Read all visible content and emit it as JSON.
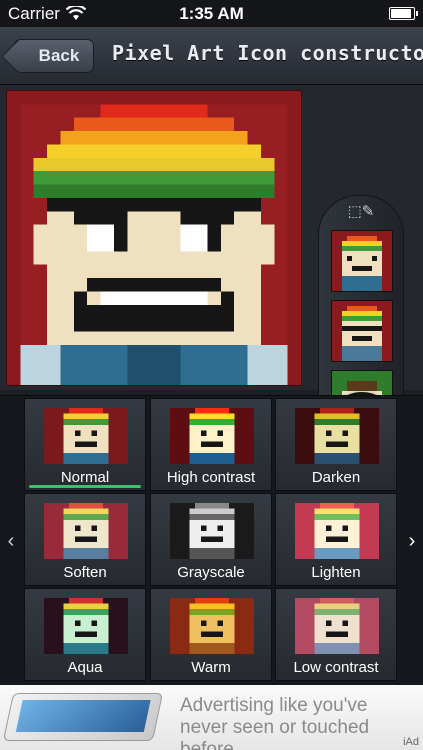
{
  "status_bar": {
    "carrier": "Carrier",
    "time": "1:35 AM",
    "battery_level": 0.95
  },
  "nav": {
    "back_label": "Back",
    "title": "Pixel Art Icon constructor"
  },
  "editor": {
    "rail_icon": "crop-edit-icon",
    "confirm_icon": "checkmark-icon"
  },
  "filters": {
    "selected": "Normal",
    "items": [
      {
        "label": "Normal",
        "bg": "#7a1a1c"
      },
      {
        "label": "High contrast",
        "bg": "#5e0e10"
      },
      {
        "label": "Darken",
        "bg": "#3a0c0e"
      },
      {
        "label": "Soften",
        "bg": "#9a2a3a"
      },
      {
        "label": "Grayscale",
        "bg": "#1a1a1a"
      },
      {
        "label": "Lighten",
        "bg": "#c43a52"
      },
      {
        "label": "Aqua",
        "bg": "#2a0f1c"
      },
      {
        "label": "Warm",
        "bg": "#8a2a12"
      },
      {
        "label": "Low contrast",
        "bg": "#b24a62"
      }
    ]
  },
  "ad": {
    "text": "Advertising like you've never seen or touched before.",
    "tag": "iAd"
  },
  "colors": {
    "accent_green": "#3ec06a",
    "nav_bg": "#2e333b"
  }
}
